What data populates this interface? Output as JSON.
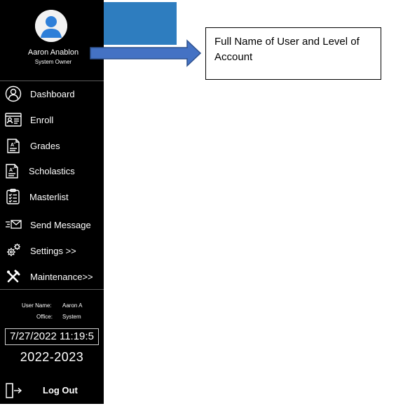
{
  "profile": {
    "name": "Aaron Anablon",
    "level": "System Owner"
  },
  "nav": {
    "items": [
      {
        "label": "Dashboard",
        "icon": "dashboard-person-icon"
      },
      {
        "label": "Enroll",
        "icon": "id-card-icon"
      },
      {
        "label": "Grades",
        "icon": "grade-sheet-icon"
      },
      {
        "label": "Scholastics",
        "icon": "scholastic-sheet-icon"
      },
      {
        "label": "Masterlist",
        "icon": "checklist-icon"
      },
      {
        "label": "Send Message",
        "icon": "send-envelope-icon"
      },
      {
        "label": "Settings >>",
        "icon": "gears-icon"
      },
      {
        "label": "Maintenance>>",
        "icon": "tools-icon"
      }
    ]
  },
  "user_info": {
    "user_name_label": "User Name:",
    "user_name_value": "Aaron A",
    "office_label": "Office:",
    "office_value": "System"
  },
  "datetime": "7/27/2022 11:19:5",
  "school_year": "2022-2023",
  "logout": {
    "label": "Log Out",
    "icon": "logout-door-icon"
  },
  "callout": {
    "text": "Full Name of User and Level of Account"
  },
  "colors": {
    "sidebar_bg": "#000000",
    "accent_blue": "#2e7dbf",
    "arrow_fill": "#4472c4",
    "arrow_stroke": "#2f528f"
  }
}
